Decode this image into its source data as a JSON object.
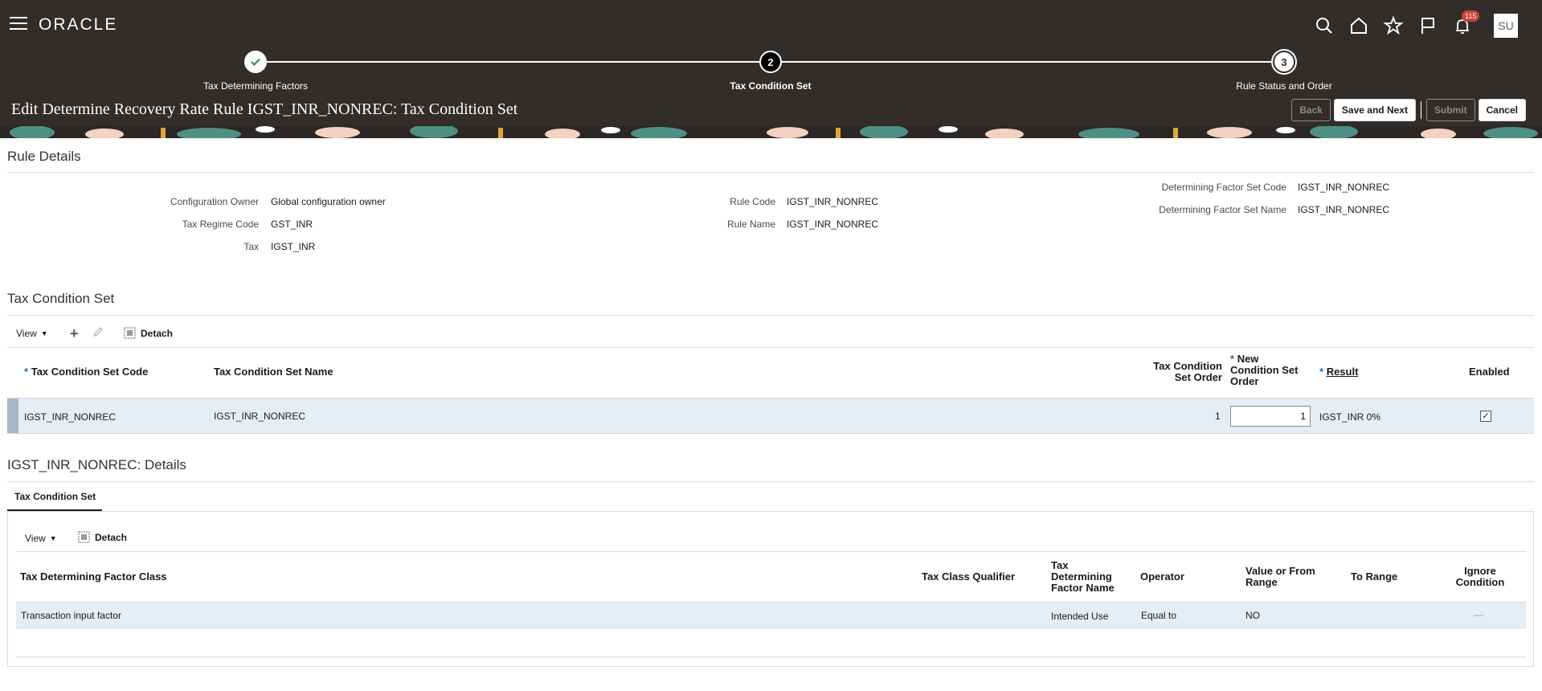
{
  "header": {
    "app_name": "ORACLE",
    "notification_count": "115",
    "avatar_initials": "SU",
    "page_title": "Edit Determine Recovery Rate Rule IGST_INR_NONREC: Tax Condition Set",
    "buttons": {
      "back": "Back",
      "save_next": "Save and Next",
      "submit": "Submit",
      "cancel": "Cancel"
    },
    "icons": [
      "search-icon",
      "home-icon",
      "star-icon",
      "flag-icon",
      "bell-icon"
    ]
  },
  "train": {
    "steps": [
      {
        "label": "Tax Determining Factors",
        "marker": "",
        "state": "done"
      },
      {
        "label": "Tax Condition Set",
        "marker": "2",
        "state": "current"
      },
      {
        "label": "Rule Status and Order",
        "marker": "3",
        "state": "future"
      }
    ]
  },
  "rule_details": {
    "title": "Rule Details",
    "configuration_owner_label": "Configuration Owner",
    "configuration_owner": "Global configuration owner",
    "tax_regime_code_label": "Tax Regime Code",
    "tax_regime_code": "GST_INR",
    "tax_label": "Tax",
    "tax": "IGST_INR",
    "rule_code_label": "Rule Code",
    "rule_code": "IGST_INR_NONREC",
    "rule_name_label": "Rule Name",
    "rule_name": "IGST_INR_NONREC",
    "dfs_code_label": "Determining Factor Set Code",
    "dfs_code": "IGST_INR_NONREC",
    "dfs_name_label": "Determining Factor Set Name",
    "dfs_name": "IGST_INR_NONREC"
  },
  "condition_set": {
    "title": "Tax Condition Set",
    "toolbar": {
      "view": "View",
      "detach": "Detach"
    },
    "columns": {
      "code": "Tax Condition Set Code",
      "name": "Tax Condition Set Name",
      "order_l1": "Tax Condition",
      "order_l2": "Set Order",
      "new_order_l1": "New",
      "new_order_l2": "Condition Set",
      "new_order_l3": "Order",
      "result": "Result",
      "enabled": "Enabled",
      "required_mark": "*"
    },
    "rows": [
      {
        "code": "IGST_INR_NONREC",
        "name": "IGST_INR_NONREC",
        "order": "1",
        "new_order": "1",
        "result": "IGST_INR 0%",
        "enabled": "✓"
      }
    ]
  },
  "details": {
    "title": "IGST_INR_NONREC: Details",
    "tab": "Tax Condition Set",
    "toolbar": {
      "view": "View",
      "detach": "Detach"
    },
    "columns": {
      "factor_class": "Tax Determining Factor Class",
      "class_qualifier": "Tax Class Qualifier",
      "factor_name_l1": "Tax",
      "factor_name_l2": "Determining",
      "factor_name_l3": "Factor Name",
      "operator": "Operator",
      "value_l1": "Value or From",
      "value_l2": "Range",
      "to_range": "To Range",
      "ignore_l1": "Ignore",
      "ignore_l2": "Condition"
    },
    "rows": [
      {
        "factor_class": "Transaction input factor",
        "class_qualifier": "",
        "factor_name": "Intended Use",
        "operator": "Equal to",
        "value": "NO",
        "to_range": "",
        "ignore": "—"
      }
    ]
  }
}
